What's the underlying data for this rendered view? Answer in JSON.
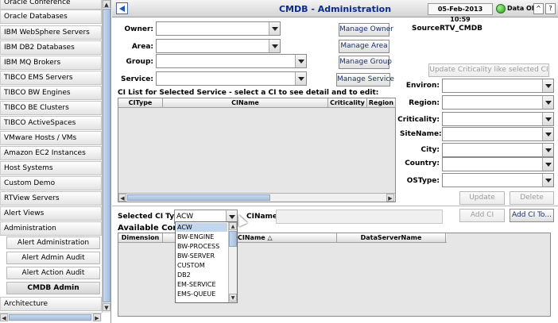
{
  "nav": {
    "items": [
      {
        "label": "Oracle Conference"
      },
      {
        "label": "Oracle Databases"
      },
      {
        "label": "IBM WebSphere Servers"
      },
      {
        "label": "IBM DB2 Databases"
      },
      {
        "label": "IBM MQ Brokers"
      },
      {
        "label": "TIBCO EMS Servers"
      },
      {
        "label": "TIBCO BW Engines"
      },
      {
        "label": "TIBCO BE Clusters"
      },
      {
        "label": "TIBCO ActiveSpaces"
      },
      {
        "label": "VMware Hosts / VMs"
      },
      {
        "label": "Amazon EC2 Instances"
      },
      {
        "label": "Host Systems"
      },
      {
        "label": "Custom Demo"
      },
      {
        "label": "RTView Servers"
      },
      {
        "label": "Alert Views"
      },
      {
        "label": "Administration"
      }
    ],
    "sub_items": [
      {
        "label": "Alert Administration"
      },
      {
        "label": "Alert Admin Audit"
      },
      {
        "label": "Alert Action Audit"
      },
      {
        "label": "CMDB Admin"
      }
    ],
    "bottom_item": {
      "label": "Architecture"
    },
    "scroll": {
      "up": "▲",
      "down": "▼",
      "left": "◀",
      "right": "▶"
    }
  },
  "header": {
    "title": "CMDB - Administration",
    "date": "05-Feb-2013 10:59",
    "status": "Data OK",
    "btn1": "^",
    "btn2": "?"
  },
  "filters": {
    "owner_label": "Owner:",
    "area_label": "Area:",
    "group_label": "Group:",
    "service_label": "Service:",
    "owner_value": "",
    "area_value": "",
    "group_value": "",
    "service_value": ""
  },
  "buttons": {
    "manage_owner": "Manage Owner",
    "manage_area": "Manage Area",
    "manage_group": "Manage Group",
    "manage_service": "Manage Service",
    "update_criticality": "Update Criticality like selected CI",
    "update": "Update",
    "delete": "Delete",
    "add_ci": "Add CI",
    "add_ci_to": "Add CI To..."
  },
  "source": {
    "label": "Source:",
    "value": "RTV_CMDB"
  },
  "ci_list": {
    "title": "CI List for Selected Service - select a CI to see detail and to edit:",
    "columns": [
      "CIType",
      "CIName",
      "Criticality",
      "Region"
    ]
  },
  "detail": {
    "environ_label": "Environ:",
    "region_label": "Region:",
    "criticality_label": "Criticality:",
    "sitename_label": "SiteName:",
    "city_label": "City:",
    "country_label": "Country:",
    "ostype_label": "OSType:"
  },
  "selected_ci": {
    "label": "Selected CI Type:",
    "value": "ACW",
    "ciname_label": "CIName:",
    "ciname_value": ""
  },
  "available": {
    "title": "Available Comp",
    "columns": [
      "Dimension",
      "CIName △",
      "DataServerName"
    ]
  },
  "dropdown": {
    "options": [
      "ACW",
      "BW-ENGINE",
      "BW-PROCESS",
      "BW-SERVER",
      "CUSTOM",
      "DB2",
      "EM-SERVICE",
      "EMS-QUEUE"
    ],
    "selected": "ACW"
  },
  "colors": {
    "title": "#0b2a8c",
    "status_ok": "#24a020",
    "selection": "#c2d6f0"
  }
}
